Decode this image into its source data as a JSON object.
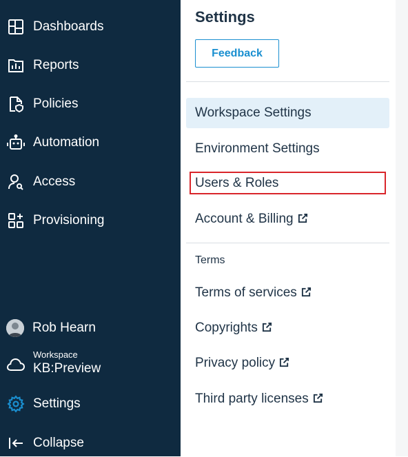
{
  "sidebar": {
    "items": [
      {
        "label": "Dashboards",
        "icon": "dashboard-icon"
      },
      {
        "label": "Reports",
        "icon": "reports-icon"
      },
      {
        "label": "Policies",
        "icon": "policies-icon"
      },
      {
        "label": "Automation",
        "icon": "robot-icon"
      },
      {
        "label": "Access",
        "icon": "user-search-icon"
      },
      {
        "label": "Provisioning",
        "icon": "provisioning-icon"
      }
    ],
    "user": {
      "name": "Rob Hearn"
    },
    "workspace": {
      "caption": "Workspace",
      "name": "KB:Preview"
    },
    "settings_label": "Settings",
    "collapse_label": "Collapse",
    "colors": {
      "background": "#0f2a40",
      "accent": "#1a8fd0"
    }
  },
  "settings_panel": {
    "title": "Settings",
    "feedback_label": "Feedback",
    "menu": [
      {
        "label": "Workspace Settings",
        "selected": true
      },
      {
        "label": "Environment Settings"
      },
      {
        "label": "Users & Roles",
        "highlighted": true
      },
      {
        "label": "Account & Billing",
        "external": true
      }
    ],
    "terms_caption": "Terms",
    "terms_links": [
      {
        "label": "Terms of services",
        "external": true
      },
      {
        "label": "Copyrights",
        "external": true
      },
      {
        "label": "Privacy policy",
        "external": true
      },
      {
        "label": "Third party licenses",
        "external": true
      }
    ]
  }
}
